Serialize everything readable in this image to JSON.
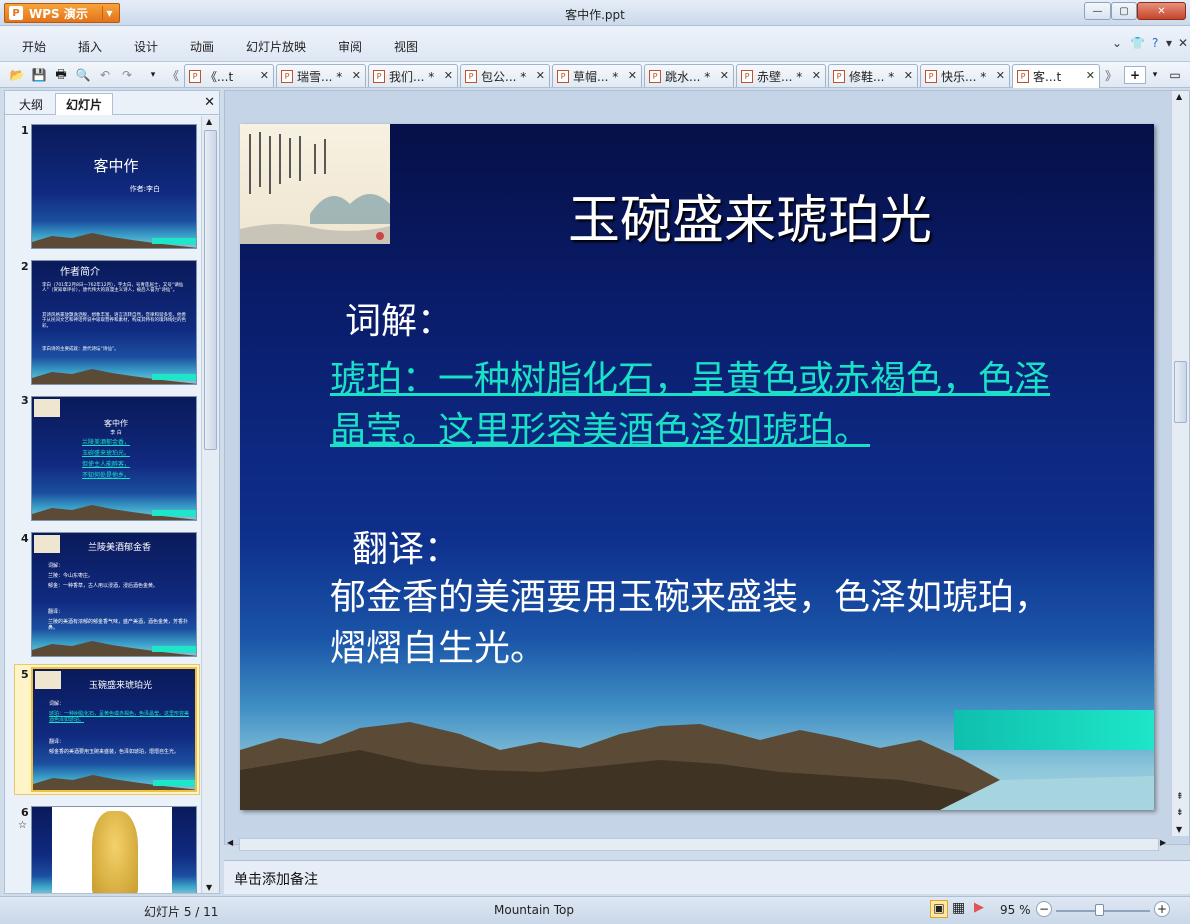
{
  "app": {
    "name": "WPS 演示",
    "title": "客中作.ppt"
  },
  "menu": [
    "开始",
    "插入",
    "设计",
    "动画",
    "幻灯片放映",
    "审阅",
    "视图"
  ],
  "tabs": [
    {
      "label": "《...t"
    },
    {
      "label": "瑞雪... *"
    },
    {
      "label": "我们... *"
    },
    {
      "label": "包公... *"
    },
    {
      "label": "草帽... *"
    },
    {
      "label": "跳水... *"
    },
    {
      "label": "赤壁... *"
    },
    {
      "label": "修鞋... *"
    },
    {
      "label": "快乐... *"
    },
    {
      "label": "客...t"
    }
  ],
  "panel": {
    "tab_outline": "大纲",
    "tab_slides": "幻灯片"
  },
  "thumbnails": [
    {
      "num": "1",
      "title": "客中作",
      "sub": "作者:李白"
    },
    {
      "num": "2",
      "title": "作者简介",
      "lines": [
        "李白（701年2月8日—762年12月），字太白，号青莲居士，又号“谪仙人”（贺知章评价），唐代伟大的浪漫主义诗人，被后人誉为“诗仙”。",
        "其诗风格豪放飘逸洒脱，想象丰富，语言流转自然，音律和谐多变。他善于从民间文艺和神话传说中吸取营养和素材，构成其特有的瑰玮绚烂的色彩。",
        "李白诗的主要成就：唐代诗坛“诗仙”。"
      ]
    },
    {
      "num": "3",
      "title": "客中作",
      "sub": "李 白",
      "lines": [
        "兰陵美酒郁金香，",
        "玉碗盛来琥珀光。",
        "但使主人能醉客，",
        "不知何处是他乡。"
      ]
    },
    {
      "num": "4",
      "title": "兰陵美酒郁金香",
      "lines": [
        "词解：",
        "兰陵：今山东枣庄。",
        "郁金：一种香草，古人用以浸酒，浸后酒色金黄。",
        "翻译：",
        "兰陵的美酒有浓郁的郁金香气味，盛产美酒，酒色金黄，芳香扑鼻。"
      ]
    },
    {
      "num": "5",
      "title": "玉碗盛来琥珀光",
      "lines": [
        "词解：",
        "琥珀：一种树脂化石，呈黄色或赤褐色，色泽晶莹。这里形容美酒色泽如琥珀。",
        "翻译：",
        "郁金香的美酒要用玉碗来盛装，色泽如琥珀，熠熠自生光。"
      ]
    },
    {
      "num": "6"
    }
  ],
  "slide": {
    "title": "玉碗盛来琥珀光",
    "label_explain": "词解：",
    "explain_text": "琥珀：一种树脂化石，呈黄色或赤褐色，色泽晶莹。这里形容美酒色泽如琥珀。",
    "label_translate": "翻译：",
    "translate_text": "郁金香的美酒要用玉碗来盛装，色泽如琥珀，熠熠自生光。"
  },
  "notes_placeholder": "单击添加备注",
  "status": {
    "slide_counter": "幻灯片 5 / 11",
    "theme": "Mountain Top",
    "zoom": "95 %"
  }
}
